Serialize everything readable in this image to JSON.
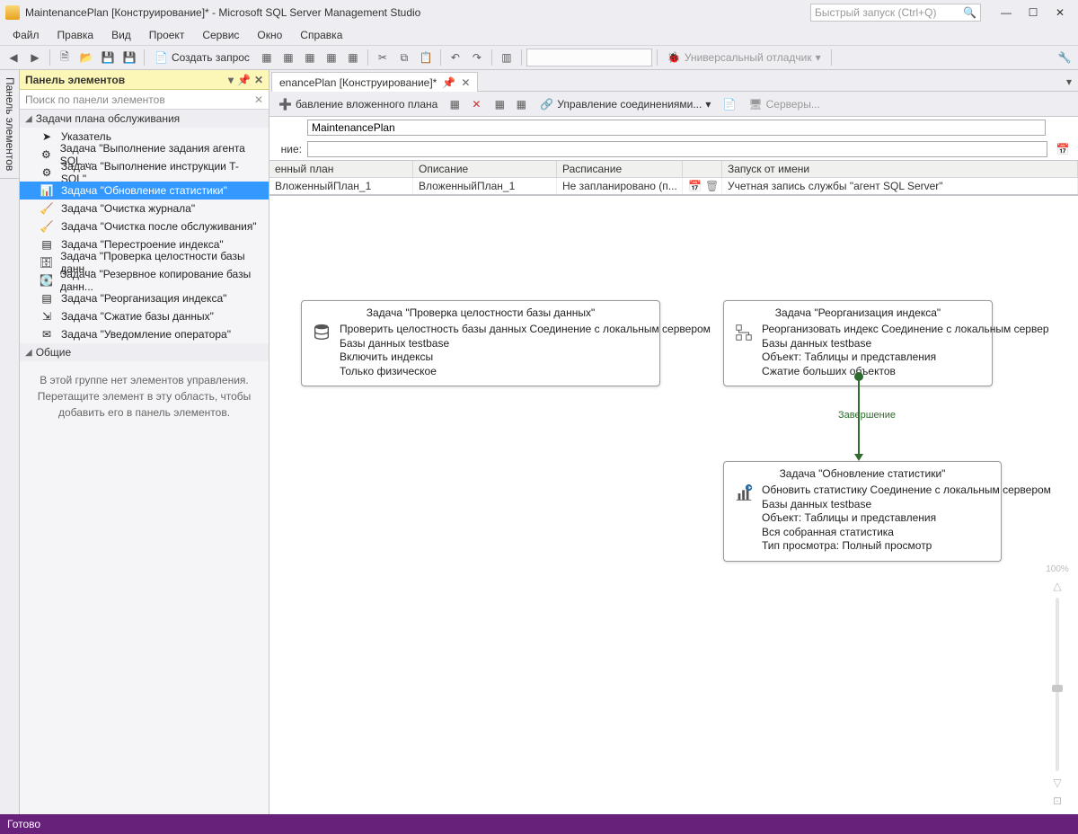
{
  "window": {
    "title": "MaintenancePlan [Конструирование]* - Microsoft SQL Server Management Studio",
    "quick_launch_placeholder": "Быстрый запуск (Ctrl+Q)"
  },
  "menus": [
    "Файл",
    "Правка",
    "Вид",
    "Проект",
    "Сервис",
    "Окно",
    "Справка"
  ],
  "toolbar": {
    "new_query": "Создать запрос",
    "debugger_label": "Универсальный отладчик"
  },
  "toolbox": {
    "title": "Панель элементов",
    "search_placeholder": "Поиск по панели элементов",
    "group1": "Задачи плана обслуживания",
    "items": [
      "Указатель",
      "Задача \"Выполнение задания агента SQL ...",
      "Задача \"Выполнение инструкции T-SQL\"",
      "Задача \"Обновление статистики\"",
      "Задача \"Очистка журнала\"",
      "Задача \"Очистка после обслуживания\"",
      "Задача \"Перестроение индекса\"",
      "Задача \"Проверка целостности базы данн...",
      "Задача \"Резервное копирование базы данн...",
      "Задача \"Реорганизация индекса\"",
      "Задача \"Сжатие базы данных\"",
      "Задача \"Уведомление оператора\""
    ],
    "group2": "Общие",
    "empty_hint": "В этой группе нет элементов управления. Перетащите элемент в эту область, чтобы добавить его в панель элементов."
  },
  "doc_tab": "enancePlan [Конструирование]*",
  "designer_toolbar": {
    "add_subplan": "бавление вложенного плана",
    "manage_connections": "Управление соединениями...",
    "servers": "Серверы..."
  },
  "plan": {
    "name_value": "MaintenancePlan",
    "desc_label": "ние:",
    "grid_headers": [
      "енный план",
      "Описание",
      "Расписание",
      "",
      "Запуск от имени"
    ],
    "grid_row": [
      "ВложенныйПлан_1",
      "ВложенныйПлан_1",
      "Не запланировано (п...",
      "",
      "Учетная запись службы \"агент SQL Server\""
    ]
  },
  "nodes": {
    "integrity": {
      "title": "Задача \"Проверка целостности базы данных\"",
      "lines": [
        "Проверить целостность базы данных Соединение с локальным сервером",
        "Базы данных testbase",
        "Включить индексы",
        "Только физическое"
      ]
    },
    "reorg": {
      "title": "Задача \"Реорганизация индекса\"",
      "lines": [
        "Реорганизовать индекс Соединение с локальным сервер",
        "Базы данных testbase",
        "Объект: Таблицы и представления",
        "Сжатие больших объектов"
      ]
    },
    "stats": {
      "title": "Задача \"Обновление статистики\"",
      "lines": [
        "Обновить статистику Соединение с локальным сервером",
        "Базы данных testbase",
        "Объект: Таблицы и представления",
        "Вся собранная статистика",
        "Тип просмотра: Полный просмотр"
      ]
    },
    "link_label": "Завершение"
  },
  "zoom_pct": "100%",
  "status": "Готово",
  "side_tab": "Панель элементов"
}
